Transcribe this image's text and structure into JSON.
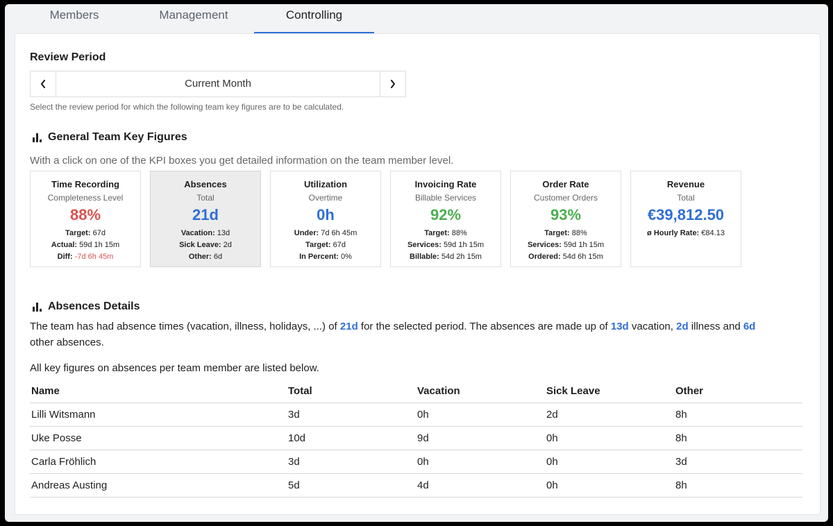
{
  "tabs": [
    {
      "label": "Members"
    },
    {
      "label": "Management"
    },
    {
      "label": "Controlling"
    }
  ],
  "review": {
    "title": "Review Period",
    "value": "Current Month",
    "hint": "Select the review period for which the following team key figures are to be calculated."
  },
  "general": {
    "title": "General Team Key Figures",
    "intro": "With a click on one of the KPI boxes you get detailed information on the team member level."
  },
  "kpis": [
    {
      "title": "Time Recording",
      "subtitle": "Completeness Level",
      "value": "88%",
      "color": "#d9534f",
      "lines": [
        [
          "Target:",
          "67d"
        ],
        [
          "Actual:",
          "59d 1h 15m"
        ],
        [
          "Diff:",
          "-7d 6h 45m"
        ]
      ]
    },
    {
      "title": "Absences",
      "subtitle": "Total",
      "value": "21d",
      "color": "#2f6fd6",
      "lines": [
        [
          "Vacation:",
          "13d"
        ],
        [
          "Sick Leave:",
          "2d"
        ],
        [
          "Other:",
          "6d"
        ]
      ]
    },
    {
      "title": "Utilization",
      "subtitle": "Overtime",
      "value": "0h",
      "color": "#2f6fd6",
      "lines": [
        [
          "Under:",
          "7d 6h 45m"
        ],
        [
          "Target:",
          "67d"
        ],
        [
          "In Percent:",
          "0%"
        ]
      ]
    },
    {
      "title": "Invoicing Rate",
      "subtitle": "Billable Services",
      "value": "92%",
      "color": "#4caf50",
      "lines": [
        [
          "Target:",
          "88%"
        ],
        [
          "Services:",
          "59d 1h 15m"
        ],
        [
          "Billable:",
          "54d 2h 15m"
        ]
      ]
    },
    {
      "title": "Order Rate",
      "subtitle": "Customer Orders",
      "value": "93%",
      "color": "#4caf50",
      "lines": [
        [
          "Target:",
          "88%"
        ],
        [
          "Services:",
          "59d 1h 15m"
        ],
        [
          "Ordered:",
          "54d 6h 15m"
        ]
      ]
    },
    {
      "title": "Revenue",
      "subtitle": "Total",
      "value": "€39,812.50",
      "color": "#2f6fd6",
      "lines": [
        [
          "ø Hourly Rate:",
          "€84.13"
        ]
      ]
    }
  ],
  "absences": {
    "title": "Absences Details",
    "p1_a": "The team has had absence times (vacation, illness, holidays, ...) of ",
    "p1_total": "21d",
    "p1_b": " for the selected period. The absences are made up of ",
    "p1_vac": "13d",
    "p1_c": " vacation, ",
    "p1_ill": "2d",
    "p1_d": " illness and ",
    "p1_other": "6d",
    "p1_e": "other absences.",
    "p2": "All key figures on absences per team member are listed below.",
    "columns": [
      "Name",
      "Total",
      "Vacation",
      "Sick Leave",
      "Other"
    ],
    "rows": [
      [
        "Lilli Witsmann",
        "3d",
        "0h",
        "2d",
        "8h"
      ],
      [
        "Uke Posse",
        "10d",
        "9d",
        "0h",
        "8h"
      ],
      [
        "Carla Fröhlich",
        "3d",
        "0h",
        "0h",
        "3d"
      ],
      [
        "Andreas Austing",
        "5d",
        "4d",
        "0h",
        "8h"
      ]
    ]
  }
}
